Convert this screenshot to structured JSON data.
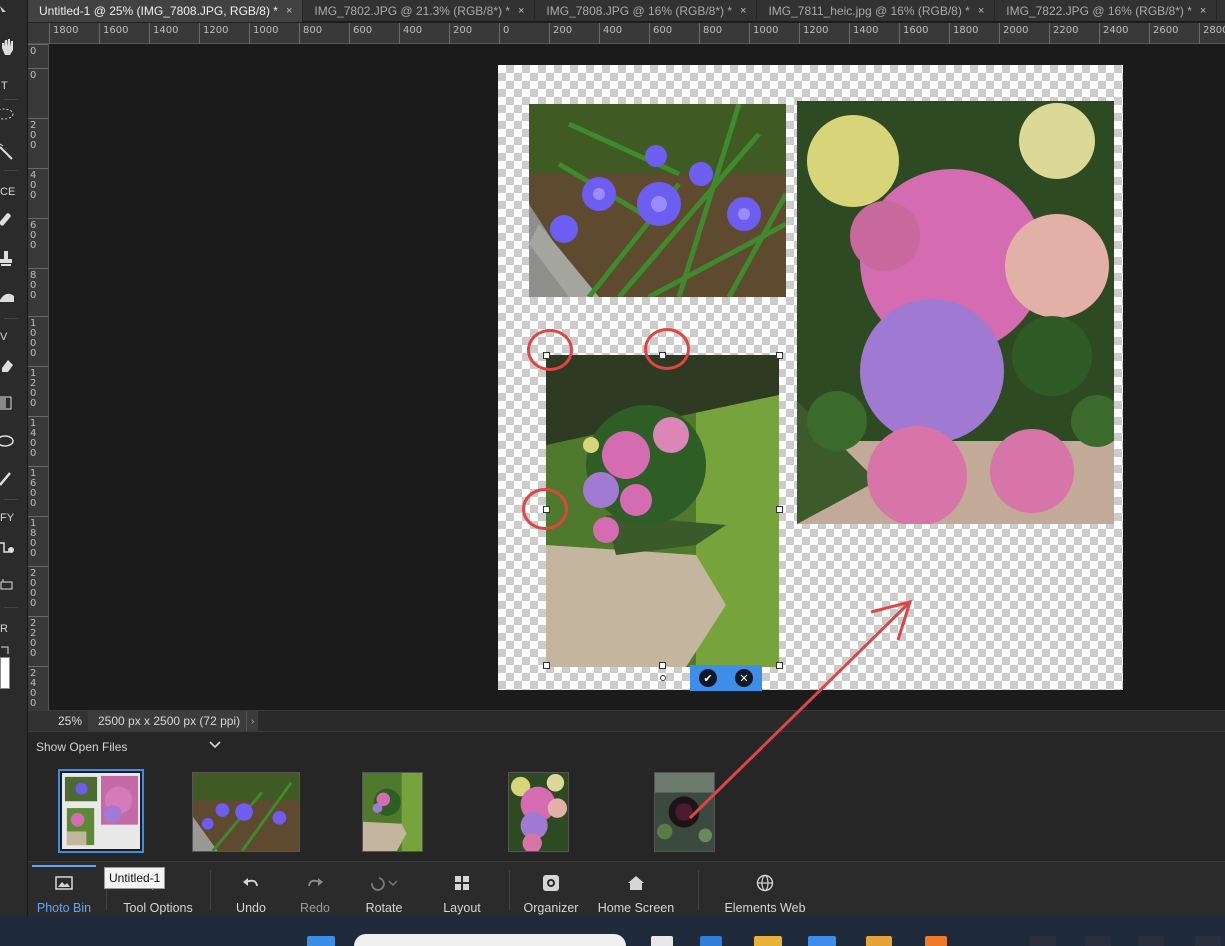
{
  "tabs": [
    {
      "label": "Untitled-1 @ 25% (IMG_7808.JPG, RGB/8) *",
      "active": true
    },
    {
      "label": "IMG_7802.JPG @ 21.3% (RGB/8*) *",
      "active": false
    },
    {
      "label": "IMG_7808.JPG @ 16% (RGB/8*) *",
      "active": false
    },
    {
      "label": "IMG_7811_heic.jpg @ 16% (RGB/8) *",
      "active": false
    },
    {
      "label": "IMG_7822.JPG @ 16% (RGB/8*) *",
      "active": false
    }
  ],
  "tab_close_glyph": "×",
  "ruler_top": [
    "1800",
    "1600",
    "1400",
    "1200",
    "1000",
    "800",
    "600",
    "400",
    "200",
    "0",
    "200",
    "400",
    "600",
    "800",
    "1000",
    "1200",
    "1400",
    "1600",
    "1800",
    "2000",
    "2200",
    "2400",
    "2600",
    "2800"
  ],
  "ruler_left": [
    "0",
    "0",
    "2\n0\n0",
    "4\n0\n0",
    "6\n0\n0",
    "8\n0\n0",
    "1\n0\n0\n0",
    "1\n2\n0\n0",
    "1\n4\n0\n0",
    "1\n6\n0\n0",
    "1\n8\n0\n0",
    "2\n0\n0\n0",
    "2\n2\n0\n0",
    "2\n4\n0\n0"
  ],
  "toolbar": {
    "labels": {
      "type": "T",
      "enhance": "CE",
      "view": "V",
      "modify": "FY",
      "color": "R"
    }
  },
  "commit": {
    "ok_glyph": "✔",
    "cancel_glyph": "✕"
  },
  "status": {
    "zoom": "25%",
    "doc_size": "2500 px x 2500 px (72 ppi)",
    "arrow": "›"
  },
  "photo_bin": {
    "header": "Show Open Files"
  },
  "taskbar": {
    "photo_bin": "Photo Bin",
    "tool_options": "Tool Options",
    "undo": "Undo",
    "redo": "Redo",
    "rotate": "Rotate",
    "layout": "Layout",
    "organizer": "Organizer",
    "home_screen": "Home Screen",
    "elements_web": "Elements Web",
    "tooltip": "Untitled-1"
  },
  "colors": {
    "accent": "#3d8ee8",
    "annotation_red": "#e04545"
  }
}
